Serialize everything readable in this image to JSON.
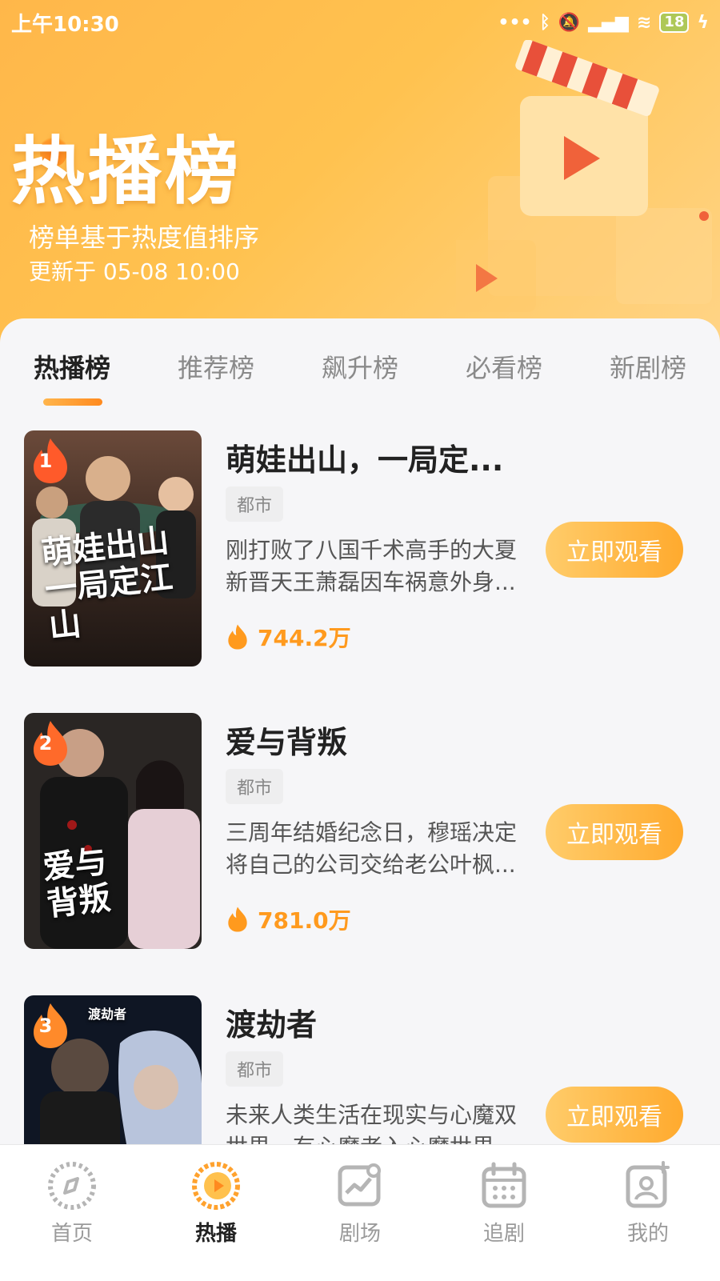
{
  "status_bar": {
    "time": "上午10:30",
    "battery": "18"
  },
  "header": {
    "title": "热播榜",
    "subtitle": "榜单基于热度值排序",
    "update_time": "更新于 05-08 10:00"
  },
  "tabs": [
    {
      "label": "热播榜",
      "active": true
    },
    {
      "label": "推荐榜",
      "active": false
    },
    {
      "label": "飙升榜",
      "active": false
    },
    {
      "label": "必看榜",
      "active": false
    },
    {
      "label": "新剧榜",
      "active": false
    }
  ],
  "items": [
    {
      "rank": "1",
      "title": "萌娃出山，一局定...",
      "tag": "都市",
      "desc_line1": "刚打败了八国千术高手的大夏",
      "desc_line2": "新晋天王萧磊因车祸意外身...",
      "heat": "744.2万",
      "button": "立即观看",
      "poster_text": "萌娃出山\n一局定江山"
    },
    {
      "rank": "2",
      "title": "爱与背叛",
      "tag": "都市",
      "desc_line1": "三周年结婚纪念日，穆瑶决定",
      "desc_line2": "将自己的公司交给老公叶枫...",
      "heat": "781.0万",
      "button": "立即观看",
      "poster_text": "爱与\n背叛"
    },
    {
      "rank": "3",
      "title": "渡劫者",
      "tag": "都市",
      "desc_line1": "未来人类生活在现实与心魔双",
      "desc_line2": "世界，有心魔者入心魔世界...",
      "heat": "",
      "button": "立即观看",
      "poster_text": "渡劫者"
    }
  ],
  "bottom_nav": [
    {
      "label": "首页",
      "icon": "compass-icon",
      "active": false
    },
    {
      "label": "热播",
      "icon": "play-circle-icon",
      "active": true
    },
    {
      "label": "剧场",
      "icon": "chart-icon",
      "active": false
    },
    {
      "label": "追剧",
      "icon": "calendar-icon",
      "active": false
    },
    {
      "label": "我的",
      "icon": "profile-icon",
      "active": false
    }
  ],
  "colors": {
    "accent": "#ff9a1e",
    "header_bg": "#ffc24f",
    "button": "#ffb03a"
  }
}
